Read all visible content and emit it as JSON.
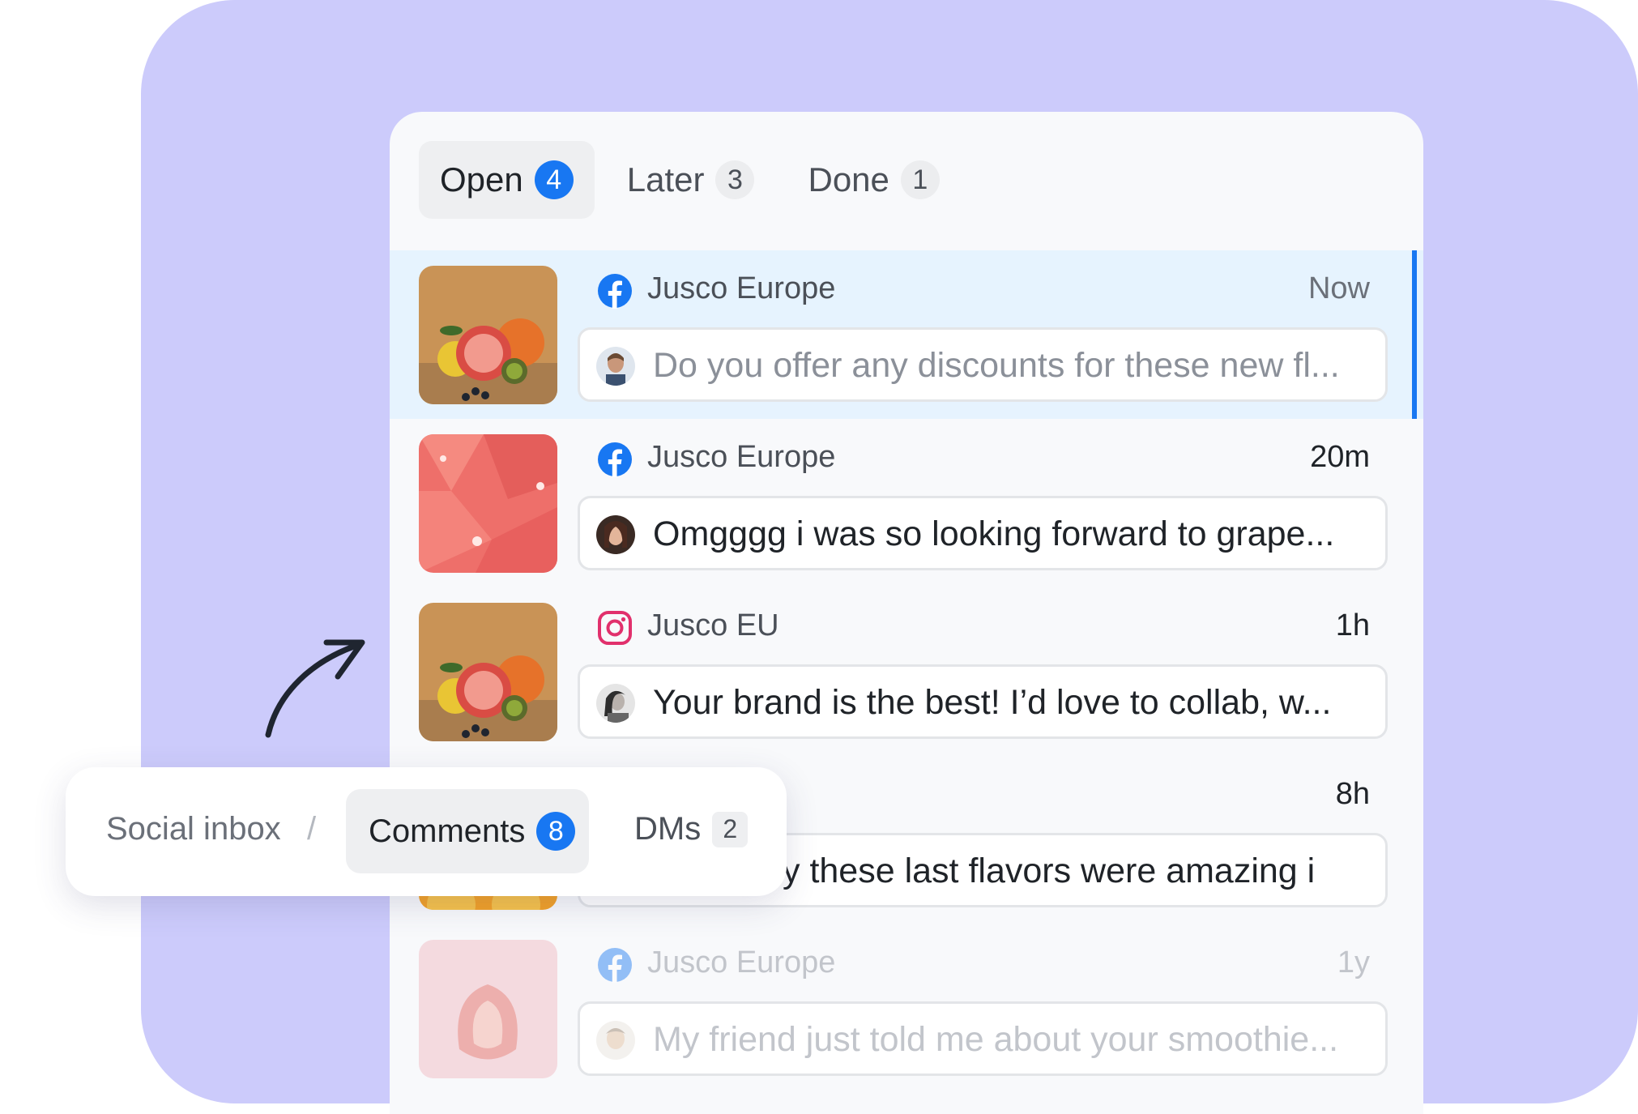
{
  "tabs": [
    {
      "label": "Open",
      "count": "4"
    },
    {
      "label": "Later",
      "count": "3"
    },
    {
      "label": "Done",
      "count": "1"
    }
  ],
  "colors": {
    "accent": "#1877f2",
    "background": "#cccbfb",
    "selected_row": "#e6f3fe",
    "instagram": "#e1306c"
  },
  "items": [
    {
      "network": "facebook-icon",
      "source": "Jusco Europe",
      "time": "Now",
      "message": "Do you offer any discounts for these new fl..."
    },
    {
      "network": "facebook-icon",
      "source": "Jusco Europe",
      "time": "20m",
      "message": "Omgggg i was so looking forward to grape..."
    },
    {
      "network": "instagram-icon",
      "source": "Jusco EU",
      "time": "1h",
      "message": "Your brand is the best! I’d love to collab, w..."
    },
    {
      "network": "",
      "source": "",
      "time": "8h",
      "message": "y these last flavors were amazing i"
    },
    {
      "network": "facebook-icon",
      "source": "Jusco Europe",
      "time": "1y",
      "message": "My friend just told me about your smoothie..."
    }
  ],
  "breadcrumb": {
    "root": "Social inbox",
    "separator": "/",
    "current": "Comments",
    "current_count": "8",
    "other": "DMs",
    "other_count": "2"
  }
}
